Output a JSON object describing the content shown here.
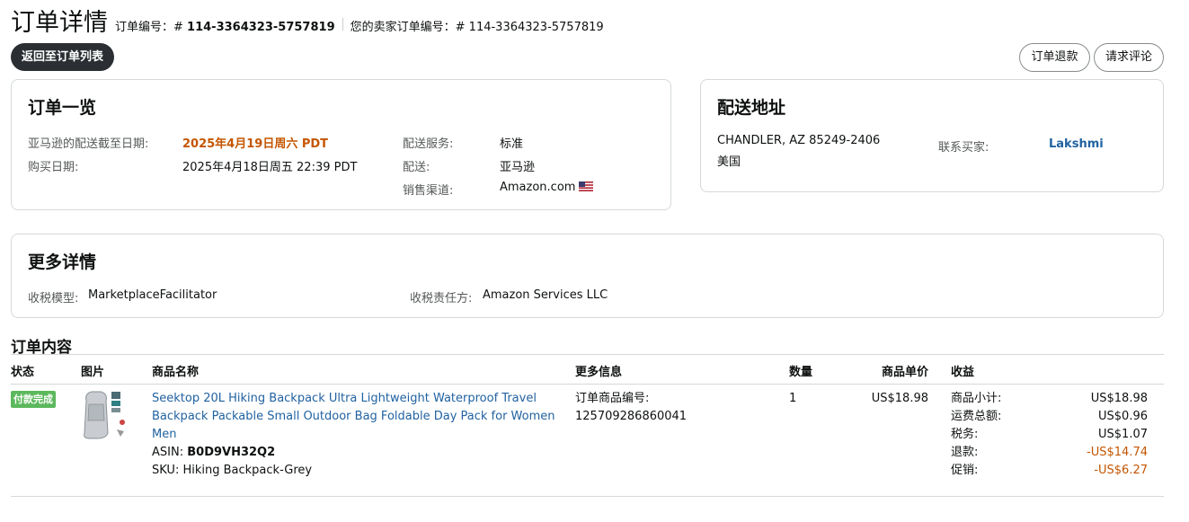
{
  "header": {
    "title": "订单详情",
    "order_id_label": "订单编号：#",
    "order_id": "114-3364323-5757819",
    "seller_order_id_label": "您的卖家订单编号：#",
    "seller_order_id": "114-3364323-5757819",
    "back_button": "返回至订单列表",
    "refund_button": "订单退款",
    "review_button": "请求评论"
  },
  "order_summary": {
    "title": "订单一览",
    "ship_by_label": "亚马逊的配送截至日期:",
    "ship_by_value": "2025年4月19日周六 PDT",
    "purchase_date_label": "购买日期:",
    "purchase_date_value": "2025年4月18日周五 22:39 PDT",
    "shipping_service_label": "配送服务:",
    "shipping_service_value": "标准",
    "fulfillment_label": "配送:",
    "fulfillment_value": "亚马逊",
    "sales_channel_label": "销售渠道:",
    "sales_channel_value": "Amazon.com",
    "flag_icon": "us-flag-icon"
  },
  "shipping_address": {
    "title": "配送地址",
    "line1": "CHANDLER, AZ 85249-2406",
    "line2": "美国",
    "contact_label": "联系买家:",
    "buyer_name": "Lakshmi"
  },
  "more_details": {
    "title": "更多详情",
    "tax_model_label": "收税模型:",
    "tax_model_value": "MarketplaceFacilitator",
    "tax_party_label": "收税责任方:",
    "tax_party_value": "Amazon Services LLC"
  },
  "order_contents": {
    "title": "订单内容",
    "columns": [
      "状态",
      "图片",
      "商品名称",
      "更多信息",
      "数量",
      "商品单价",
      "收益"
    ],
    "items": [
      {
        "status": "付款完成",
        "product_name": "Seektop 20L Hiking Backpack Ultra Lightweight Waterproof Travel Backpack Packable Small Outdoor Bag Foldable Day Pack for Women Men",
        "asin_label": "ASIN:",
        "asin": "B0D9VH32Q2",
        "sku_label": "SKU:",
        "sku": "Hiking Backpack-Grey",
        "item_id_label": "订单商品编号:",
        "item_id": "125709286860041",
        "quantity": "1",
        "unit_price": "US$18.98",
        "proceeds": [
          {
            "label": "商品小计:",
            "value": "US$18.98"
          },
          {
            "label": "运费总额:",
            "value": "US$0.96"
          },
          {
            "label": "税务:",
            "value": "US$1.07"
          },
          {
            "label": "退款:",
            "value": "-US$14.74"
          },
          {
            "label": "促销:",
            "value": "-US$6.27"
          }
        ]
      }
    ]
  },
  "colors": {
    "accent_orange": "#c45500",
    "link_blue": "#2162a1",
    "status_green": "#5cb85c",
    "dark_button": "#2b2f33"
  }
}
